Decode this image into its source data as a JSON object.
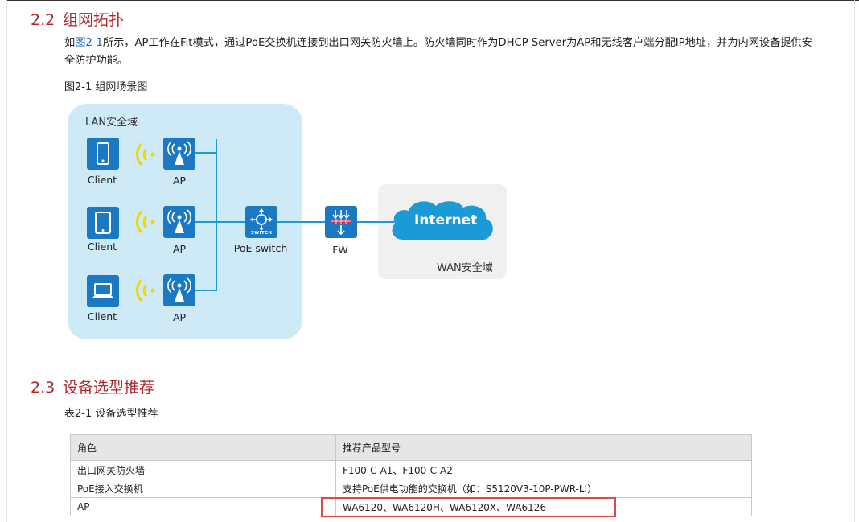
{
  "sections": {
    "topology": {
      "number": "2.2",
      "title": "组网拓扑",
      "para_prefix": "如",
      "para_link": "图2-1",
      "para_rest": "所示，AP工作在Fit模式，通过PoE交换机连接到出口网关防火墙上。防火墙同时作为DHCP Server为AP和无线客户端分配IP地址，并为内网设备提供安全防护功能。",
      "figure_caption": "图2-1 组网场景图"
    },
    "selection": {
      "number": "2.3",
      "title": "设备选型推荐",
      "table_caption": "表2-1 设备选型推荐"
    }
  },
  "diagram": {
    "lan_label": "LAN安全域",
    "wan_label": "WAN安全域",
    "client_label": "Client",
    "ap_label": "AP",
    "switch_label": "PoE switch",
    "switch_badge": "SWITCH",
    "fw_label": "FW",
    "internet_label": "Internet"
  },
  "table": {
    "headers": [
      "角色",
      "推荐产品型号"
    ],
    "rows": [
      [
        "出口网关防火墙",
        "F100-C-A1、F100-C-A2"
      ],
      [
        "PoE接入交换机",
        "支持PoE供电功能的交换机（如：S5120V3-10P-PWR-LI）"
      ],
      [
        "AP",
        "WA6120、WA6120H、WA6120X、WA6126"
      ]
    ]
  },
  "colors": {
    "heading": "#b0272b",
    "device": "#1b78c2",
    "link": "#1b9ad6",
    "lan_zone": "#cfeaf7",
    "wan_zone": "#f0f0f0",
    "wifi": "#f2d600",
    "highlight": "#e04747"
  }
}
